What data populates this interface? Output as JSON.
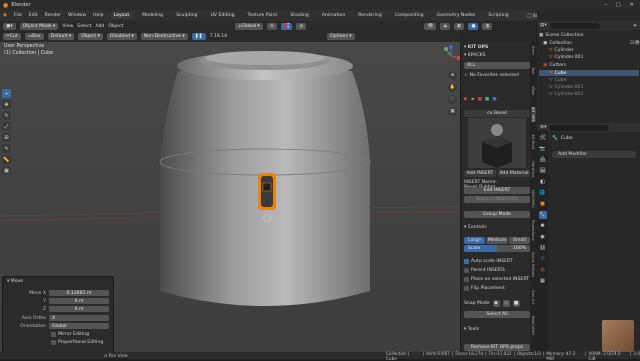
{
  "app": {
    "window_title": "Blender"
  },
  "menubar": {
    "menus": [
      "File",
      "Edit",
      "Render",
      "Window",
      "Help"
    ],
    "workspaces": [
      "Layout",
      "Modeling",
      "Sculpting",
      "UV Editing",
      "Texture Paint",
      "Shading",
      "Animation",
      "Rendering",
      "Compositing",
      "Geometry Nodes",
      "Scripting"
    ],
    "active_workspace": "Layout",
    "scene": "Scene",
    "view_layer": "ViewLayer"
  },
  "viewport_header": {
    "tool": "Cut",
    "box": "Box",
    "mode_default": "Default",
    "object": "Object",
    "disabled": "Disabled",
    "nondestructive": "Non-Destructive",
    "version": "7.19.14",
    "mode": "Object Mode",
    "menus": [
      "View",
      "Select",
      "Add",
      "Object"
    ],
    "orientation": "Global",
    "options": "Options"
  },
  "viewport_overlay": {
    "perspective": "User Perspective",
    "collection": "(1) Collection | Cube"
  },
  "redo_panel": {
    "title": "Move",
    "move_x_label": "Move X",
    "move_x": "0.12681 m",
    "y_label": "Y",
    "y": "0 m",
    "z_label": "Z",
    "z": "0 m",
    "axis_ortho_label": "Axis Ortho",
    "axis_ortho": "X",
    "orientation_label": "Orientation",
    "orientation": "Global",
    "mirror_editing": "Mirror Editing",
    "proportional_editing": "Proportional Editing"
  },
  "npanel": {
    "header": "KIT OPS",
    "kpacks_label": "KPACKS",
    "kpack_value": "ALL",
    "no_favorites": "No Favorites selected",
    "insert_name_label": "INSERT Name: Bevel_Rubber...",
    "thumbnail_label": "ce Bevel",
    "add_insert": "Add INSERT",
    "add_material": "Add Material",
    "edit_insert": "Edit INSERT",
    "replace_insert": "Replace INSERT(S)",
    "group_mode": "Group Mode",
    "controls_label": "Controls",
    "sizes": [
      "Large",
      "Medium",
      "Small"
    ],
    "scale_label": "Scale",
    "scale_value": "100%",
    "auto_scale": "Auto scale INSERT",
    "parent_inserts": "Parent INSERTs",
    "place_on_selected": "Place on selected INSERT",
    "flip_placement": "Flip Placement",
    "snap_mode_label": "Snap Mode",
    "select_all": "Select All",
    "tools_label": "Tools",
    "remove_kitops": "Remove KIT OPS props"
  },
  "npanel_tabs": [
    "Item",
    "Tool",
    "View",
    "KIT OPS",
    "3D-Print",
    "HardOps",
    "MACHIN3",
    "PowerSave",
    "Quick Retopo",
    "Zen UV",
    "BoxCutter"
  ],
  "outliner": {
    "root": "Scene Collection",
    "items": [
      {
        "name": "Collection",
        "depth": 1,
        "selected": false
      },
      {
        "name": "Cylinder",
        "depth": 2,
        "selected": false
      },
      {
        "name": "Cylinder.001",
        "depth": 2,
        "selected": false
      },
      {
        "name": "Cutters",
        "depth": 1,
        "selected": false
      },
      {
        "name": "Cube",
        "depth": 2,
        "selected": true
      },
      {
        "name": "Cube",
        "depth": 2,
        "selected": false
      },
      {
        "name": "Cylinder.001",
        "depth": 2,
        "selected": false
      },
      {
        "name": "Cylinder.002",
        "depth": 2,
        "selected": false
      }
    ]
  },
  "properties": {
    "object_name": "Cube",
    "add_modifier": "Add Modifier"
  },
  "statusbar": {
    "left": "Pan View",
    "right_items": [
      "Collection | Cube",
      "Verts:9,667",
      "Faces:18,274",
      "Tris:37,022",
      "Objects:1/3",
      "Memory: 47.3 MiB",
      "VRAM: 2.0/24.0 GiB",
      "3.0"
    ]
  },
  "colors": {
    "accent": "#3d69a8",
    "selection_orange": "#e8830f",
    "selected_row": "#3f5670"
  }
}
